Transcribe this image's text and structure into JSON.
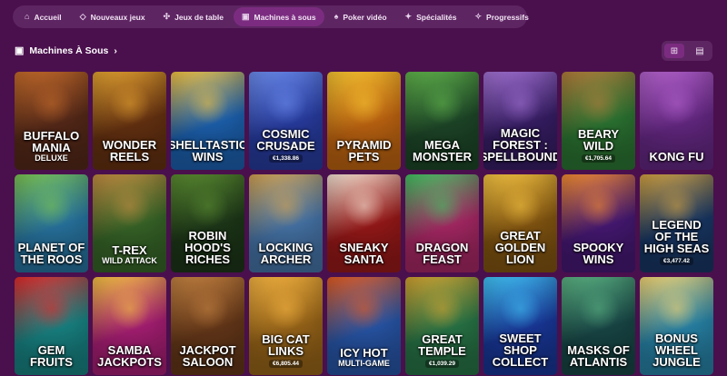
{
  "nav": {
    "items": [
      {
        "label": "Accueil",
        "icon": "⌂",
        "icon_name": "home-icon",
        "active": false
      },
      {
        "label": "Nouveaux jeux",
        "icon": "◇",
        "icon_name": "diamond-icon",
        "active": false
      },
      {
        "label": "Jeux de table",
        "icon": "✣",
        "icon_name": "chips-icon",
        "active": false
      },
      {
        "label": "Machines à sous",
        "icon": "▣",
        "icon_name": "slot-machine-icon",
        "active": true
      },
      {
        "label": "Poker vidéo",
        "icon": "♠",
        "icon_name": "cards-icon",
        "active": false
      },
      {
        "label": "Spécialités",
        "icon": "✦",
        "icon_name": "specialties-icon",
        "active": false
      },
      {
        "label": "Progressifs",
        "icon": "✧",
        "icon_name": "progressive-icon",
        "active": false
      }
    ]
  },
  "section": {
    "title": "Machines À Sous",
    "chevron": "›"
  },
  "view_toggle": {
    "grid_icon": "⊞",
    "list_icon": "▤"
  },
  "games": [
    {
      "name": "Buffalo Mania",
      "sub": "Deluxe",
      "jackpot": "",
      "color": "#5a2b1a",
      "accent": "#c26a2a"
    },
    {
      "name": "Wonder Reels",
      "sub": "",
      "jackpot": "",
      "color": "#6b3412",
      "accent": "#e0a030"
    },
    {
      "name": "Shelltastic Wins",
      "sub": "",
      "jackpot": "",
      "color": "#1e66b8",
      "accent": "#f0c040"
    },
    {
      "name": "Cosmic Crusade",
      "sub": "",
      "jackpot": "€1,338.86",
      "color": "#2a3fa8",
      "accent": "#6a8ae8"
    },
    {
      "name": "Pyramid Pets",
      "sub": "",
      "jackpot": "",
      "color": "#c96a12",
      "accent": "#f0c030"
    },
    {
      "name": "Mega Monster",
      "sub": "",
      "jackpot": "",
      "color": "#1f4a2a",
      "accent": "#5fb04a"
    },
    {
      "name": "Magic Forest : Spellbound",
      "sub": "",
      "jackpot": "",
      "color": "#3a1f6a",
      "accent": "#a070d0"
    },
    {
      "name": "Beary Wild",
      "sub": "",
      "jackpot": "€1,705.64",
      "color": "#2e7a35",
      "accent": "#b07a3a"
    },
    {
      "name": "Kong Fu",
      "sub": "",
      "jackpot": "",
      "color": "#6a2a8a",
      "accent": "#b060c8"
    },
    {
      "name": "Planet of the Roos",
      "sub": "",
      "jackpot": "",
      "color": "#2a7aa8",
      "accent": "#7ac050"
    },
    {
      "name": "T-Rex",
      "sub": "Wild Attack",
      "jackpot": "",
      "color": "#3a6a2a",
      "accent": "#c08a40"
    },
    {
      "name": "Robin Hood's Riches",
      "sub": "",
      "jackpot": "",
      "color": "#1f3a1a",
      "accent": "#5a8a30"
    },
    {
      "name": "Locking Archer",
      "sub": "",
      "jackpot": "",
      "color": "#4a7ab0",
      "accent": "#d0a050"
    },
    {
      "name": "Sneaky Santa",
      "sub": "",
      "jackpot": "",
      "color": "#a01a1a",
      "accent": "#f0e0d0"
    },
    {
      "name": "Dragon Feast",
      "sub": "",
      "jackpot": "",
      "color": "#b02a6a",
      "accent": "#40c060"
    },
    {
      "name": "Great Golden Lion",
      "sub": "",
      "jackpot": "",
      "color": "#8a5a12",
      "accent": "#f0c040"
    },
    {
      "name": "Spooky Wins",
      "sub": "",
      "jackpot": "",
      "color": "#4a1a7a",
      "accent": "#f08a30"
    },
    {
      "name": "Legend of the High Seas",
      "sub": "",
      "jackpot": "€3,477.42",
      "color": "#1a3a6a",
      "accent": "#d0a040"
    },
    {
      "name": "Gem Fruits",
      "sub": "",
      "jackpot": "",
      "color": "#1a8a8a",
      "accent": "#e02a2a"
    },
    {
      "name": "Samba Jackpots",
      "sub": "",
      "jackpot": "",
      "color": "#b0207a",
      "accent": "#f0c040"
    },
    {
      "name": "Jackpot Saloon",
      "sub": "",
      "jackpot": "",
      "color": "#6a3a1a",
      "accent": "#c08040"
    },
    {
      "name": "Big Cat Links",
      "sub": "",
      "jackpot": "€6,805.44",
      "color": "#a06a1a",
      "accent": "#f0b040"
    },
    {
      "name": "Icy Hot",
      "sub": "Multi-Game",
      "jackpot": "",
      "color": "#2a5ab0",
      "accent": "#e05a20"
    },
    {
      "name": "Great Temple",
      "sub": "",
      "jackpot": "€1,039.29",
      "color": "#2a7a4a",
      "accent": "#d0a030"
    },
    {
      "name": "Sweet Shop Collect",
      "sub": "",
      "jackpot": "",
      "color": "#1a3aa0",
      "accent": "#40c0f0"
    },
    {
      "name": "Masks of Atlantis",
      "sub": "",
      "jackpot": "",
      "color": "#1a4a4a",
      "accent": "#5ab080"
    },
    {
      "name": "Bonus Wheel Jungle",
      "sub": "",
      "jackpot": "",
      "color": "#2a8ab0",
      "accent": "#f0d070"
    }
  ]
}
